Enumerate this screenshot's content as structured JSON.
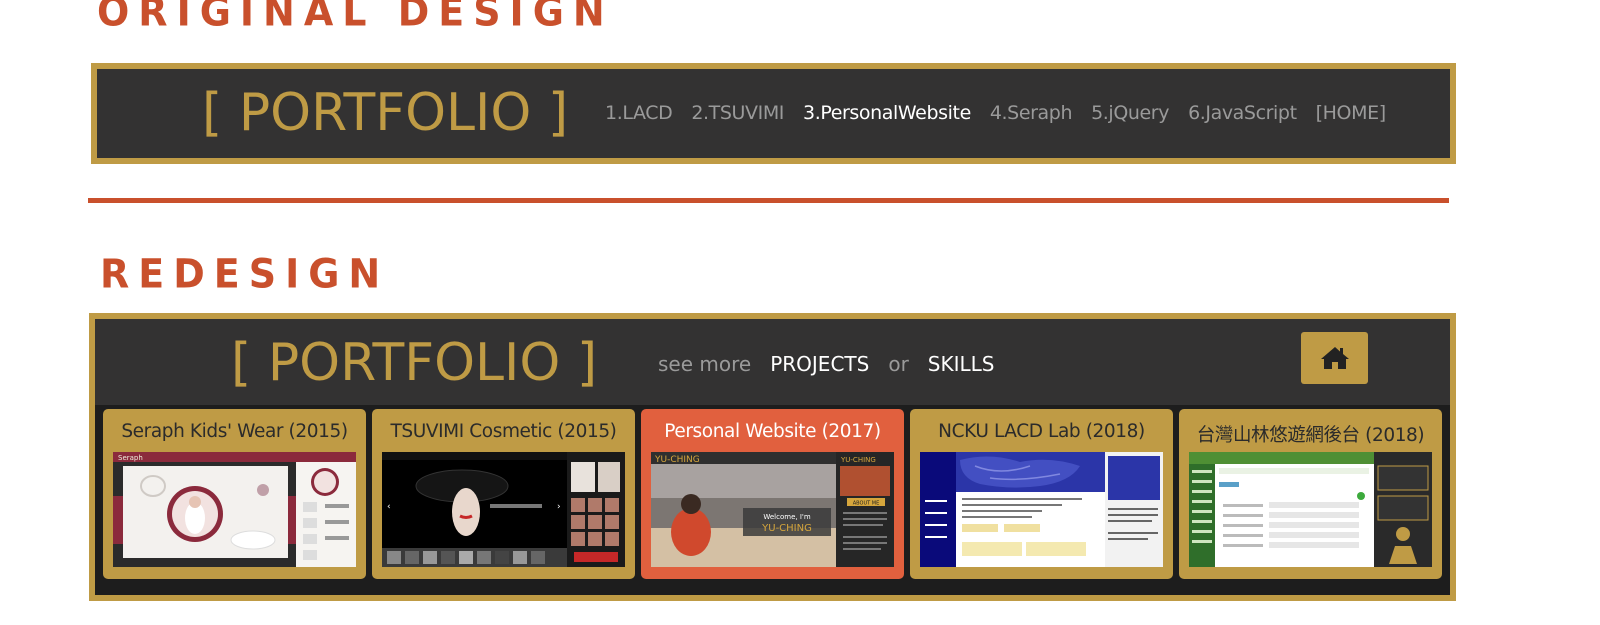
{
  "headings": {
    "original": "ORIGINAL DESIGN",
    "redesign": "REDESIGN"
  },
  "original": {
    "logo": "[ PORTFOLIO ]",
    "nav": [
      "1.LACD",
      "2.TSUVIMI",
      "3.PersonalWebsite",
      "4.Seraph",
      "5.jQuery",
      "6.JavaScript",
      "[HOME]"
    ],
    "active_index": 2
  },
  "redesign": {
    "logo": "[ PORTFOLIO ]",
    "see_more": "see more",
    "projects": "PROJECTS",
    "or": "or",
    "skills": "SKILLS",
    "home_icon": "home-icon",
    "cards": [
      {
        "title": "Seraph Kids' Wear (2015)",
        "active": false
      },
      {
        "title": "TSUVIMI Cosmetic (2015)",
        "active": false
      },
      {
        "title": "Personal Website (2017)",
        "active": true
      },
      {
        "title": "NCKU LACD Lab (2018)",
        "active": false
      },
      {
        "title": "台灣山林悠遊網後台 (2018)",
        "active": false
      }
    ],
    "thumb_texts": {
      "personal_brand": "YU-CHING",
      "welcome": "Welcome, I'm",
      "about": "ABOUT ME",
      "seraph_brand": "Seraph"
    }
  },
  "colors": {
    "accent": "#c9502c",
    "gold": "#bf9b45",
    "bar": "#333232",
    "active_card": "#e1603e"
  }
}
